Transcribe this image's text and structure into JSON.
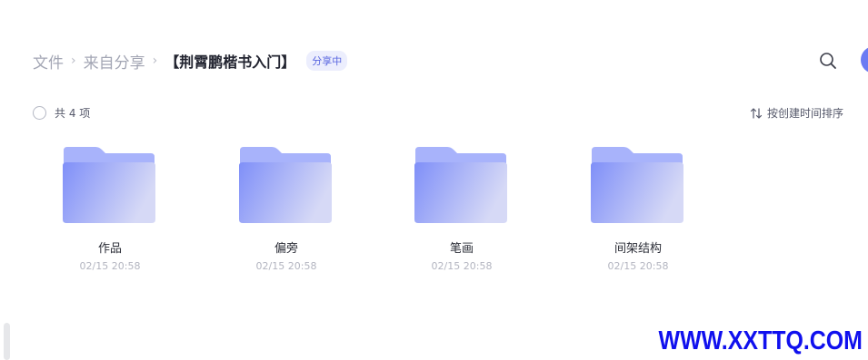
{
  "breadcrumb": {
    "items": [
      "文件",
      "来自分享"
    ],
    "separator": "›",
    "current": "【荆霄鹏楷书入门】",
    "badge": "分享中"
  },
  "toolbar": {
    "search_icon": "search-icon",
    "count_text": "共 4 项",
    "sort_label": "按创建时间排序"
  },
  "folders": [
    {
      "name": "作品",
      "date": "02/15 20:58"
    },
    {
      "name": "偏旁",
      "date": "02/15 20:58"
    },
    {
      "name": "笔画",
      "date": "02/15 20:58"
    },
    {
      "name": "间架结构",
      "date": "02/15 20:58"
    }
  ],
  "watermark": "WWW.XXTTQ.COM",
  "colors": {
    "accent": "#5865e0",
    "folder_back": "#a8b3fb",
    "folder_front_start": "#7f8ff8",
    "folder_front_end": "#d6d9f6",
    "watermark": "#1010ee"
  }
}
